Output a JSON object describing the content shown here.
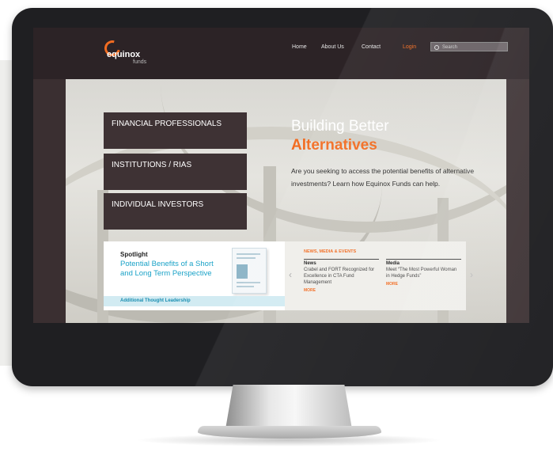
{
  "brand": {
    "name": "equinox",
    "sub": "funds"
  },
  "nav": [
    "Home",
    "About Us",
    "Contact",
    "Login"
  ],
  "search": {
    "placeholder": "Search"
  },
  "audiences": [
    "FINANCIAL PROFESSIONALS",
    "INSTITUTIONS / RIAS",
    "INDIVIDUAL INVESTORS"
  ],
  "hero": {
    "title_line1": "Building Better",
    "title_line2": "Alternatives",
    "description": "Are you seeking to access the potential benefits of alternative investments? Learn how Equinox Funds can help."
  },
  "spotlight": {
    "label": "Spotlight",
    "title": "Potential Benefits of a Short and Long Term Perspective",
    "more": "Additional Thought Leadership"
  },
  "news": {
    "label": "NEWS, MEDIA & EVENTS",
    "items": [
      {
        "heading": "News",
        "body": "Crabel and FORT Recognized for Excellence in CTA Fund Management",
        "more": "MORE"
      },
      {
        "heading": "Media",
        "body": "Meet “The Most Powerful Woman in Hedge Funds”",
        "more": "MORE"
      }
    ]
  },
  "colors": {
    "accent": "#f26c21",
    "header": "#2c2326",
    "spotlight_title": "#1aa2c7"
  },
  "icons": {
    "search": "search-icon",
    "prev": "chevron-left-icon",
    "next": "chevron-right-icon"
  }
}
